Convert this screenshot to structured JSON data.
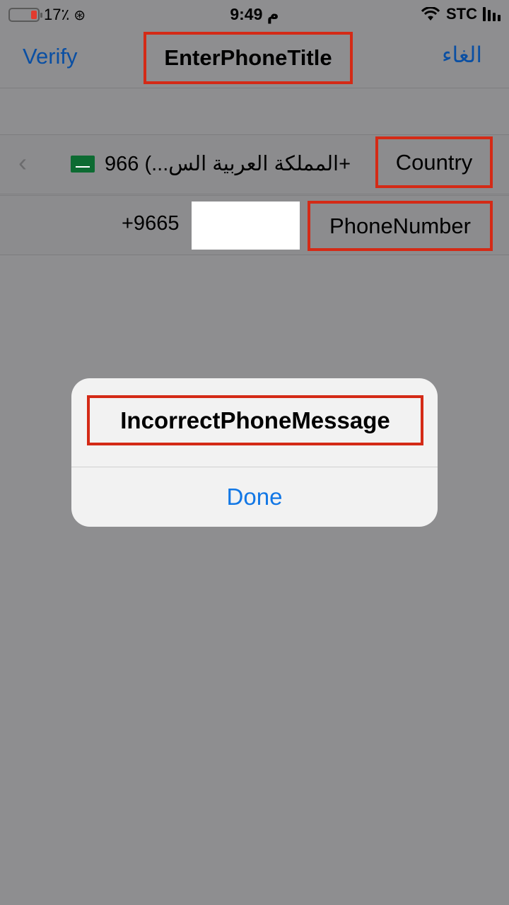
{
  "status_bar": {
    "battery_percent": "17٪",
    "time": "9:49 م",
    "carrier": "STC",
    "battery_level": 0.17,
    "icons": [
      "battery-icon",
      "orientation-lock-icon",
      "wifi-icon",
      "signal-icon"
    ]
  },
  "nav": {
    "left_action": "Verify",
    "title": "EnterPhoneTitle",
    "right_action": "الغاء"
  },
  "form": {
    "country_label": "Country",
    "country_value": "المملكة العربية الس...) 966+",
    "flag_icon": "saudi-arabia-flag-icon",
    "phone_label": "PhoneNumber",
    "phone_prefix": "+9665",
    "phone_value": ""
  },
  "alert": {
    "message": "IncorrectPhoneMessage",
    "button_label": "Done"
  },
  "colors": {
    "overlay": "#8e8e90",
    "link": "#0a4fa3",
    "alert_button": "#1277e5",
    "highlight_border": "#d42a16"
  }
}
